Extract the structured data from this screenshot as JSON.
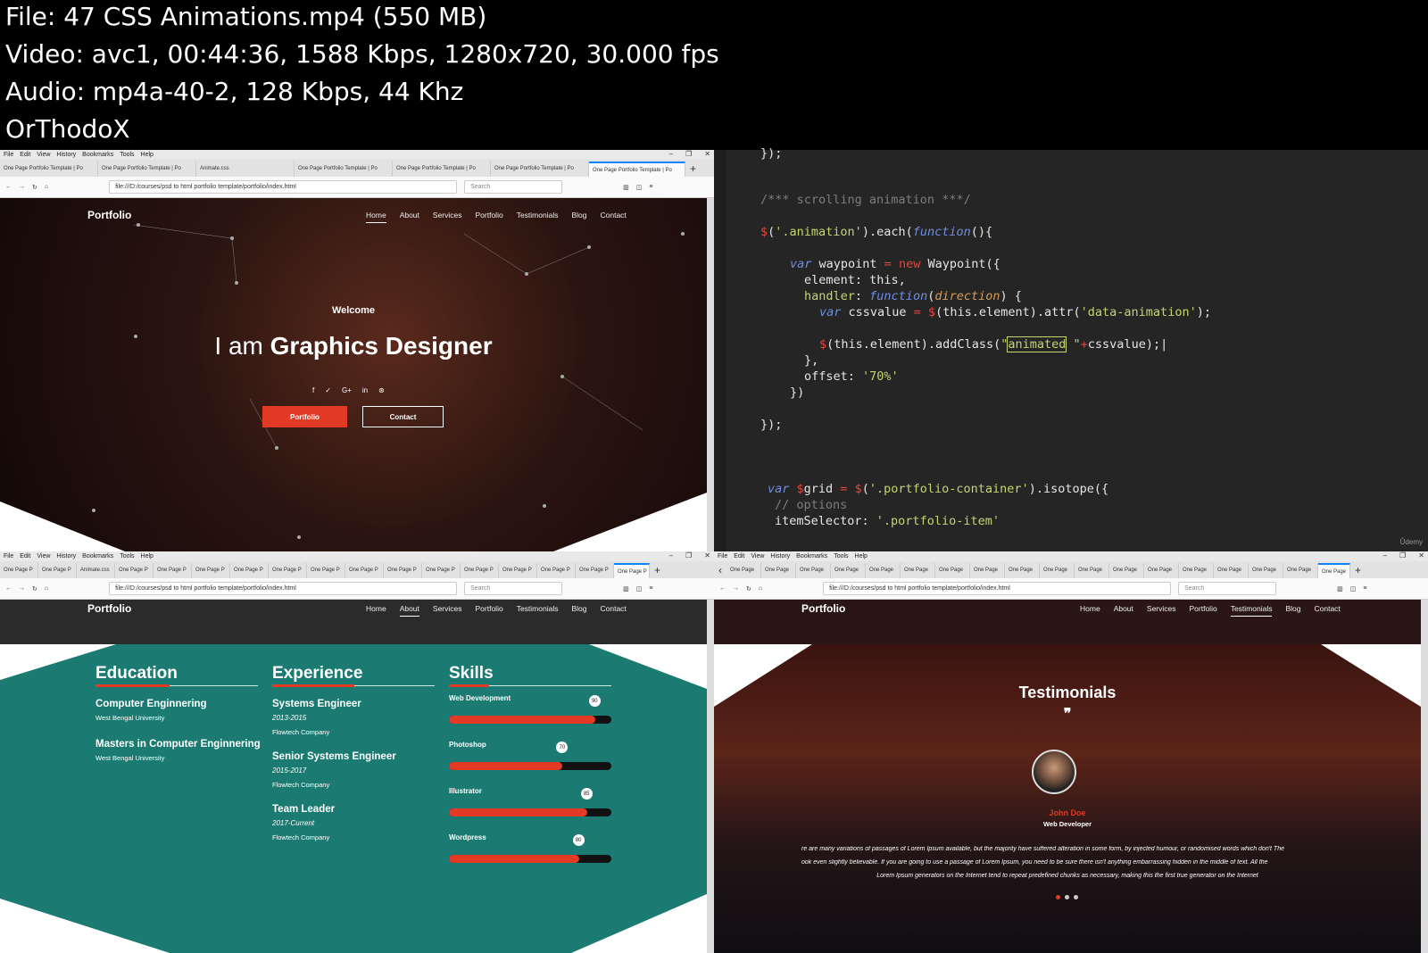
{
  "header": {
    "line1": "File: 47  CSS Animations.mp4 (550 MB)",
    "line2": "Video: avc1, 00:44:36, 1588 Kbps, 1280x720, 30.000 fps",
    "line3": "Audio: mp4a-40-2, 128 Kbps, 44 Khz",
    "line4": "OrThodoX"
  },
  "browser": {
    "menu": [
      "File",
      "Edit",
      "View",
      "History",
      "Bookmarks",
      "Tools",
      "Help"
    ],
    "url": "file:///D:/courses/psd to html portfolio template/portfolio/index.html",
    "search_placeholder": "Search",
    "tabs_top": [
      "One Page Portfolio Template | Po",
      "One Page Portfolio Template | Po",
      "Animate.css",
      "One Page Portfolio Template | Po",
      "One Page Portfolio Template | Po",
      "One Page Portfolio Template | Po",
      "One Page Portfolio Template | Po"
    ],
    "tab_short": "One Page P",
    "tab_animate": "Animate.css",
    "tab_short2": "One Page"
  },
  "site": {
    "logo": "Portfolio",
    "nav": [
      "Home",
      "About",
      "Services",
      "Portfolio",
      "Testimonials",
      "Blog",
      "Contact"
    ]
  },
  "hero": {
    "welcome": "Welcome",
    "title_plain": "I am ",
    "title_bold": "Graphics Designer",
    "social": [
      "f",
      "✓",
      "G+",
      "in",
      "⊛"
    ],
    "btn_portfolio": "Portfolio",
    "btn_contact": "Contact"
  },
  "code_lines": [
    "});",
    "/*** scrolling animation ***/",
    "$('.animation').each(function(){",
    "var waypoint = new Waypoint({",
    "element: this,",
    "handler: function(direction) {",
    "var cssvalue = $(this.element).attr('data-animation');",
    "$(this.element).addClass(\"animated \"+cssvalue);",
    "},",
    "offset: '70%'",
    "})",
    "});",
    "var $grid = $('.portfolio-container').isotope({",
    "// options",
    "itemSelector: '.portfolio-item'"
  ],
  "code_watermark": "Ûdemy",
  "about": {
    "education_title": "Education",
    "experience_title": "Experience",
    "skills_title": "Skills",
    "education": [
      {
        "title": "Computer Enginnering",
        "school": "West Bengal University"
      },
      {
        "title": "Masters in Computer Enginnering",
        "school": "West Bengal University"
      }
    ],
    "experience": [
      {
        "title": "Systems Engineer",
        "dates": "2013-2015",
        "company": "Flowtech Company"
      },
      {
        "title": "Senior Systems Engineer",
        "dates": "2015-2017",
        "company": "Flowtech Company"
      },
      {
        "title": "Team Leader",
        "dates": "2017-Current",
        "company": "Flowtech Company"
      }
    ],
    "skills": [
      {
        "name": "Web Development",
        "value": 90
      },
      {
        "name": "Photoshop",
        "value": 70
      },
      {
        "name": "Illustrator",
        "value": 85
      },
      {
        "name": "Wordpress",
        "value": 80
      }
    ]
  },
  "testimonials": {
    "title": "Testimonials",
    "quote_mark": "❞",
    "name": "John Doe",
    "role": "Web Developer",
    "text1": "re are many variations of passages of Lorem Ipsum available, but the majority have suffered alteration in some form, by injected humour, or randomised words which don't  The",
    "text2": "ook even slightly believable. If you are going to use a passage of Lorem Ipsum, you need to be sure there isn't anything embarrassing hidden in the middle of text. All the",
    "text3": "Lorem Ipsum generators on the Internet tend to repeat predefined chunks as necessary, making this the first true generator on the Internet"
  },
  "colors": {
    "accent": "#e23a24",
    "teal": "#1b7b72",
    "code_bg": "#252525"
  }
}
